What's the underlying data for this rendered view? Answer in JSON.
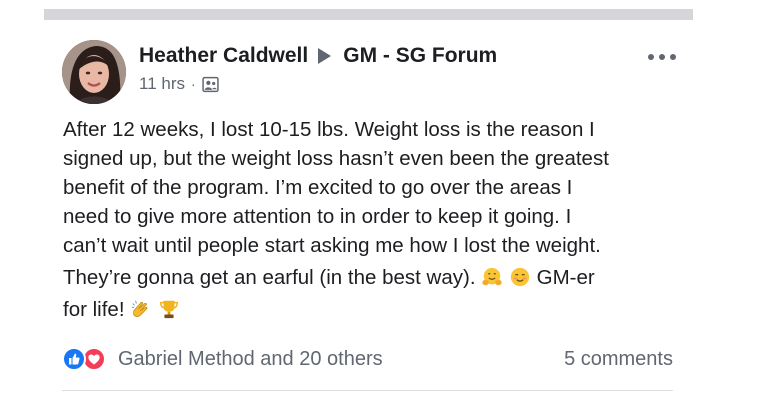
{
  "post": {
    "author": "Heather Caldwell",
    "group": "GM - SG Forum",
    "timestamp": "11 hrs",
    "meta_separator": "·",
    "audience_icon": "group-members-icon",
    "more_icon": "more-options-icon",
    "text_lines": [
      "After 12 weeks, I lost 10-15 lbs. Weight loss is the reason I",
      "signed up, but the weight loss hasn’t even been the greatest",
      "benefit of the program. I’m excited to go over the areas I",
      "need to give more attention to in order to keep it going. I",
      "can’t wait until people start asking me how I lost the weight."
    ],
    "line6_text": "They’re gonna get an earful (in the best way).",
    "line6_tail": "GM-er",
    "line7_text": "for life!",
    "emojis": [
      "hugging-face-icon",
      "smiling-face-icon",
      "clapping-hands-icon",
      "trophy-icon"
    ]
  },
  "footer": {
    "reactions_text": "Gabriel Method and 20 others",
    "comments_text": "5 comments",
    "reaction_icons": [
      "like-reaction-icon",
      "love-reaction-icon"
    ]
  },
  "colors": {
    "text": "#1c1e21",
    "secondary": "#606770",
    "like_blue": "#1877f2",
    "love_red": "#f33e58",
    "top_bar": "#d4d6d9"
  }
}
